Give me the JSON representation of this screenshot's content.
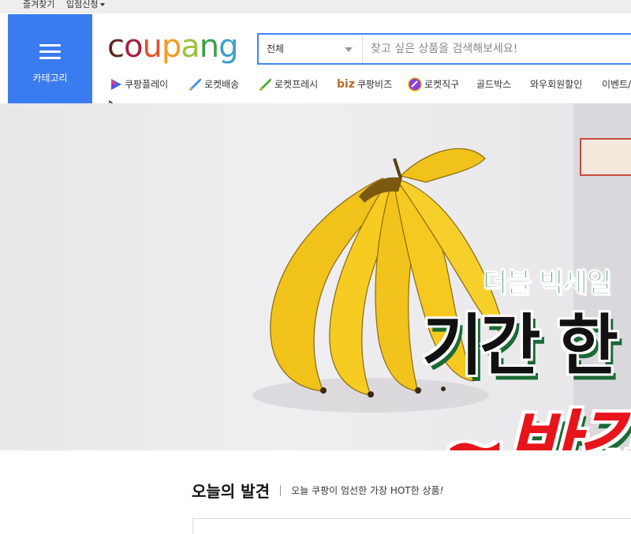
{
  "topbar": {
    "favorites": "즐겨찾기",
    "seller_signup": "입점신청"
  },
  "category": {
    "label": "카테고리"
  },
  "logo": {
    "letters": [
      "c",
      "o",
      "u",
      "p",
      "a",
      "n",
      "g"
    ],
    "colors": [
      "#5f2a1e",
      "#a0233f",
      "#e1522c",
      "#f39a1e",
      "#9bc33b",
      "#3ea04b",
      "#3ea0c9"
    ]
  },
  "search": {
    "scope": "전체",
    "placeholder": "찾고 싶은 상품을 검색해보세요!"
  },
  "nav": [
    {
      "label": "쿠팡플레이",
      "icon": "play-icon"
    },
    {
      "label": "로켓배송",
      "icon": "rocket-icon"
    },
    {
      "label": "로켓프레시",
      "icon": "rocket-fresh-icon"
    },
    {
      "label": "쿠팡비즈",
      "icon": "biz-icon",
      "prefix": "biz"
    },
    {
      "label": "로켓직구",
      "icon": "globe-rocket-icon"
    },
    {
      "label": "골드박스",
      "icon": ""
    },
    {
      "label": "와우회원할인",
      "icon": ""
    },
    {
      "label": "이벤트/",
      "icon": ""
    }
  ],
  "banner": {
    "line1": "더블 빅세일",
    "line2": "기간 한",
    "line3": "~반값"
  },
  "today": {
    "title": "오늘의 발견",
    "subtitle": "오늘 쿠팡이 엄선한 가장 HOT한 상품",
    "exclaim": "!"
  },
  "colors": {
    "accent": "#3a7cf0",
    "search_border": "#4285f4"
  }
}
